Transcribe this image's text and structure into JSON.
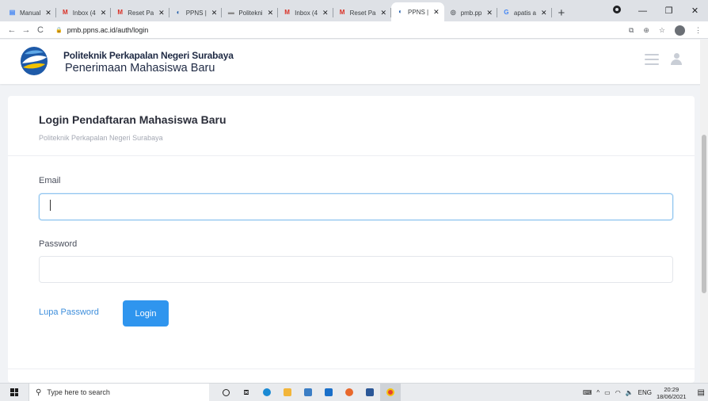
{
  "browser": {
    "tabs": [
      {
        "title": "Manual",
        "favicon_color": "#4285f4",
        "glyph": "▤",
        "active": false
      },
      {
        "title": "Inbox (4",
        "favicon_color": "#d93025",
        "glyph": "M",
        "active": false
      },
      {
        "title": "Reset Pa",
        "favicon_color": "#d93025",
        "glyph": "M",
        "active": false
      },
      {
        "title": "PPNS |",
        "favicon_color": "#1e5aa8",
        "glyph": "◐",
        "active": false
      },
      {
        "title": "Politekni",
        "favicon_color": "#8a8a8a",
        "glyph": "▬",
        "active": false
      },
      {
        "title": "Inbox (4",
        "favicon_color": "#d93025",
        "glyph": "M",
        "active": false
      },
      {
        "title": "Reset Pa",
        "favicon_color": "#d93025",
        "glyph": "M",
        "active": false
      },
      {
        "title": "PPNS |",
        "favicon_color": "#1e5aa8",
        "glyph": "◐",
        "active": true
      },
      {
        "title": "pmb.pp",
        "favicon_color": "#5f6368",
        "glyph": "◎",
        "active": false
      },
      {
        "title": "apatis a",
        "favicon_color": "#4285f4",
        "glyph": "G",
        "active": false
      }
    ],
    "new_tab_glyph": "+",
    "url": "pmb.ppns.ac.id/auth/login"
  },
  "header": {
    "institution": "Politeknik Perkapalan Negeri Surabaya",
    "app_name": "Penerimaan Mahasiswa Baru"
  },
  "login": {
    "title": "Login Pendaftaran Mahasiswa Baru",
    "subtitle": "Politeknik Perkapalan Negeri Surabaya",
    "email_label": "Email",
    "email_value": "",
    "password_label": "Password",
    "password_value": "",
    "forgot_label": "Lupa Password",
    "submit_label": "Login"
  },
  "taskbar": {
    "search_placeholder": "Type here to search",
    "language": "ENG",
    "time": "20:29",
    "date": "18/06/2021"
  },
  "colors": {
    "accent": "#2f95ee",
    "link": "#3f8fdc",
    "brand_text": "#1f2a44"
  }
}
